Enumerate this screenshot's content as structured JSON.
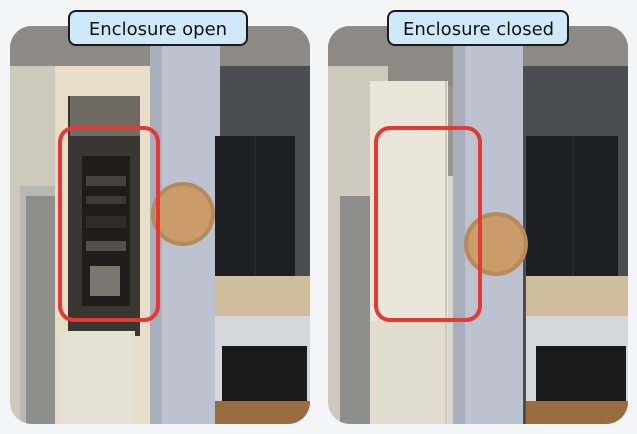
{
  "labels": {
    "left": "Enclosure open",
    "right": "Enclosure closed"
  },
  "colors": {
    "label_background": "#cfe9fb",
    "highlight": "#e53935"
  }
}
